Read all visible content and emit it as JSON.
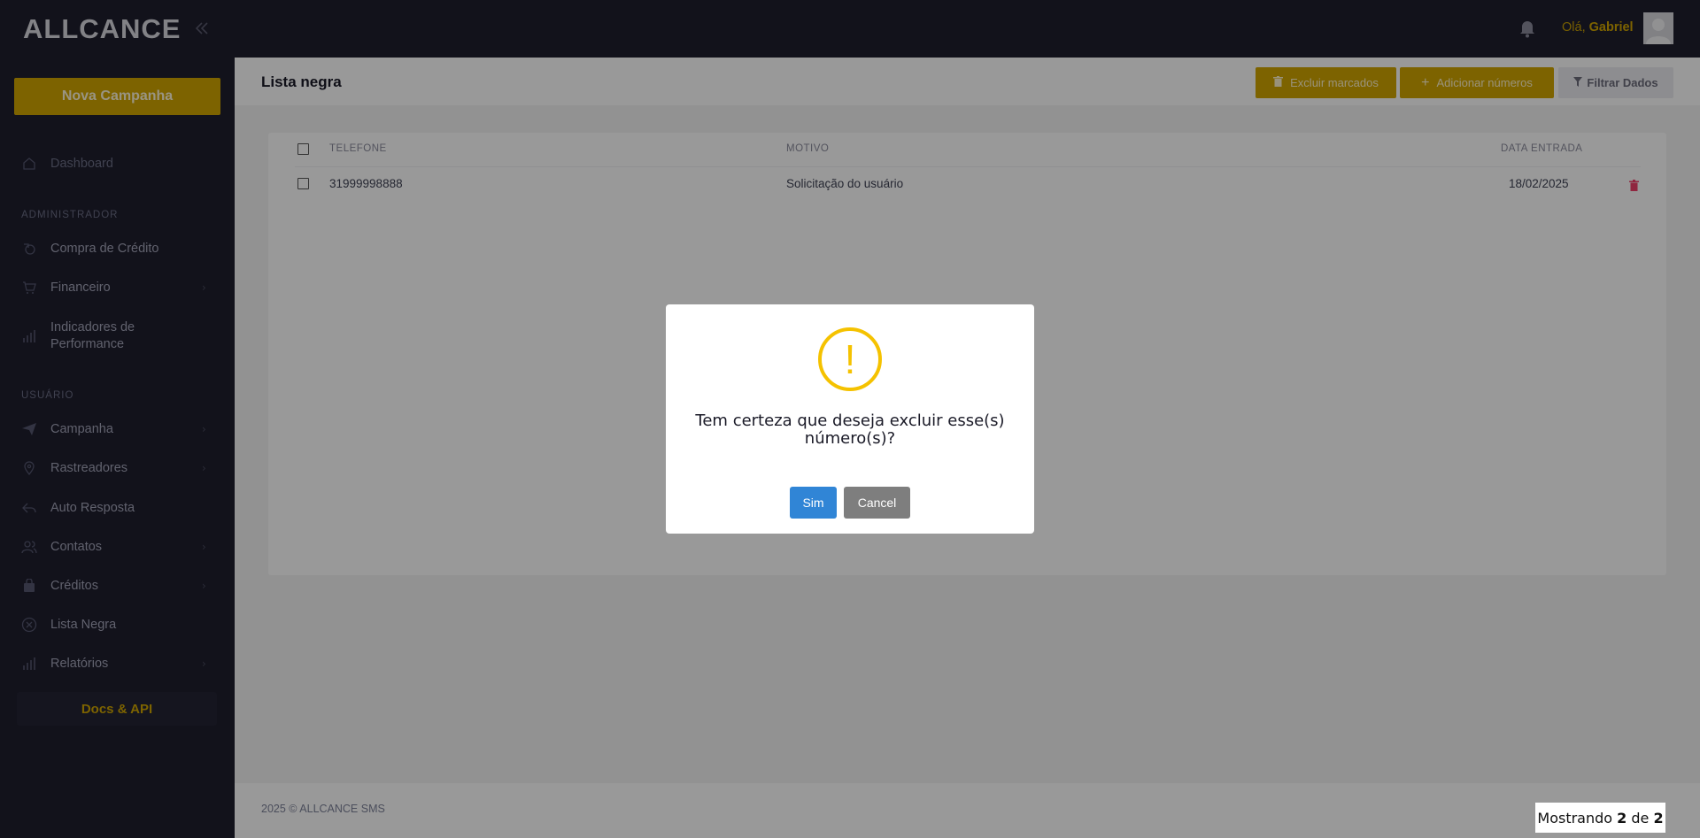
{
  "brand": {
    "logo_text": "ALLCANCE"
  },
  "sidebar": {
    "new_campaign_label": "Nova Campanha",
    "dashboard_label": "Dashboard",
    "section_admin": "ADMINISTRADOR",
    "admin_items": [
      {
        "label": "Compra de Crédito",
        "icon": "credit-purchase-icon",
        "has_arrow": false
      },
      {
        "label": "Financeiro",
        "icon": "cart-icon",
        "has_arrow": true
      },
      {
        "label_line1": "Indicadores de",
        "label_line2": "Performance",
        "icon": "bar-chart-icon",
        "has_arrow": false
      }
    ],
    "section_user": "USUÁRIO",
    "user_items": [
      {
        "label": "Campanha",
        "icon": "paper-plane-icon",
        "has_arrow": true
      },
      {
        "label": "Rastreadores",
        "icon": "location-pin-icon",
        "has_arrow": true
      },
      {
        "label": "Auto Resposta",
        "icon": "reply-icon",
        "has_arrow": false
      },
      {
        "label": "Contatos",
        "icon": "users-icon",
        "has_arrow": true
      },
      {
        "label": "Créditos",
        "icon": "bag-icon",
        "has_arrow": true
      },
      {
        "label": "Lista Negra",
        "icon": "circle-x-icon",
        "has_arrow": false
      },
      {
        "label": "Relatórios",
        "icon": "bar-chart-icon",
        "has_arrow": true
      }
    ],
    "docs_label": "Docs & API"
  },
  "topbar": {
    "greeting_prefix": "Olá, ",
    "user_name": "Gabriel"
  },
  "subheader": {
    "title": "Lista negra",
    "btn_delete_marked": "Excluir marcados",
    "btn_add_numbers": "Adicionar números",
    "btn_filter": "Filtrar Dados"
  },
  "table": {
    "headers": {
      "phone": "TELEFONE",
      "reason": "MOTIVO",
      "date": "DATA ENTRADA"
    },
    "rows": [
      {
        "phone": "31999998888",
        "reason": "Solicitação do usuário",
        "date": "18/02/2025"
      }
    ]
  },
  "footer": {
    "text": "2025 © ALLCANCE SMS"
  },
  "modal": {
    "icon": "warning-icon",
    "icon_glyph": "!",
    "message": "Tem certeza que deseja excluir esse(s) número(s)?",
    "confirm_label": "Sim",
    "cancel_label": "Cancel"
  },
  "pager_tip": {
    "prefix": "Mostrando ",
    "shown": "2",
    "mid": " de ",
    "total": "2"
  },
  "colors": {
    "sidebar_bg": "#1e1e2d",
    "accent": "#d0a600",
    "confirm": "#3085d6",
    "cancel": "#7e7e7e",
    "warning": "#f5c200",
    "danger": "#f1416c"
  }
}
